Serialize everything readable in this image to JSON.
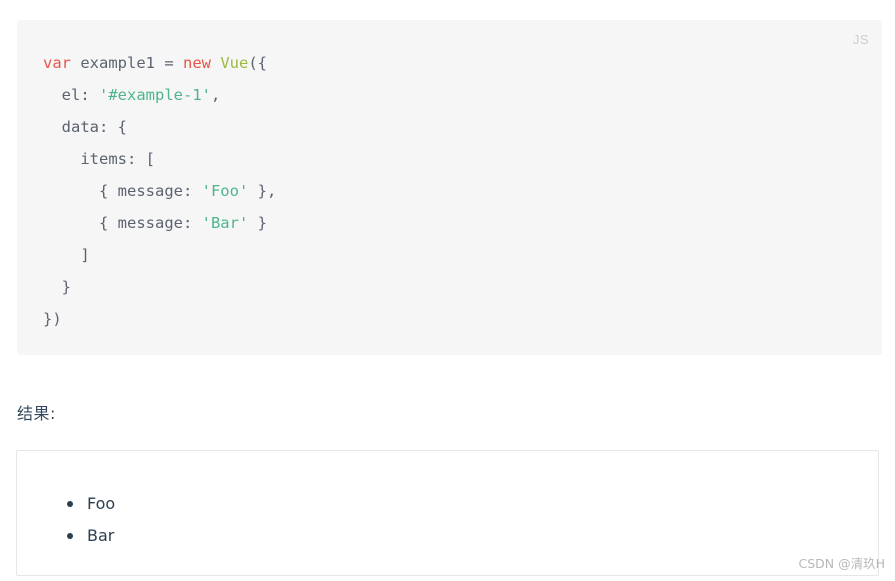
{
  "code_block": {
    "language_badge": "JS",
    "background_color": "#f6f6f6",
    "lines": [
      [
        {
          "t": "var",
          "c": "kw"
        },
        {
          "t": " example1 = ",
          "c": "plain"
        },
        {
          "t": "new",
          "c": "kw"
        },
        {
          "t": " ",
          "c": "plain"
        },
        {
          "t": "Vue",
          "c": "cls"
        },
        {
          "t": "({",
          "c": "punct"
        }
      ],
      [
        {
          "t": "  el: ",
          "c": "plain"
        },
        {
          "t": "'#example-1'",
          "c": "str"
        },
        {
          "t": ",",
          "c": "punct"
        }
      ],
      [
        {
          "t": "  data: {",
          "c": "plain"
        }
      ],
      [
        {
          "t": "    items: [",
          "c": "plain"
        }
      ],
      [
        {
          "t": "      { message: ",
          "c": "plain"
        },
        {
          "t": "'Foo'",
          "c": "str"
        },
        {
          "t": " },",
          "c": "punct"
        }
      ],
      [
        {
          "t": "      { message: ",
          "c": "plain"
        },
        {
          "t": "'Bar'",
          "c": "str"
        },
        {
          "t": " }",
          "c": "punct"
        }
      ],
      [
        {
          "t": "    ]",
          "c": "punct"
        }
      ],
      [
        {
          "t": "  }",
          "c": "punct"
        }
      ],
      [
        {
          "t": "})",
          "c": "punct"
        }
      ]
    ],
    "token_colors": {
      "keyword": "#e45649",
      "class": "#9bbb3f",
      "string": "#4db58b",
      "plain": "#5c6370",
      "badge": "#c9cdd4"
    }
  },
  "result_section": {
    "label": "结果:",
    "label_color": "#34495e",
    "items": [
      "Foo",
      "Bar"
    ],
    "item_color": "#2c3e50",
    "border_color": "#e6e6e6"
  },
  "watermark": {
    "text": "CSDN @清玖H",
    "color": "#b8b8b8"
  }
}
